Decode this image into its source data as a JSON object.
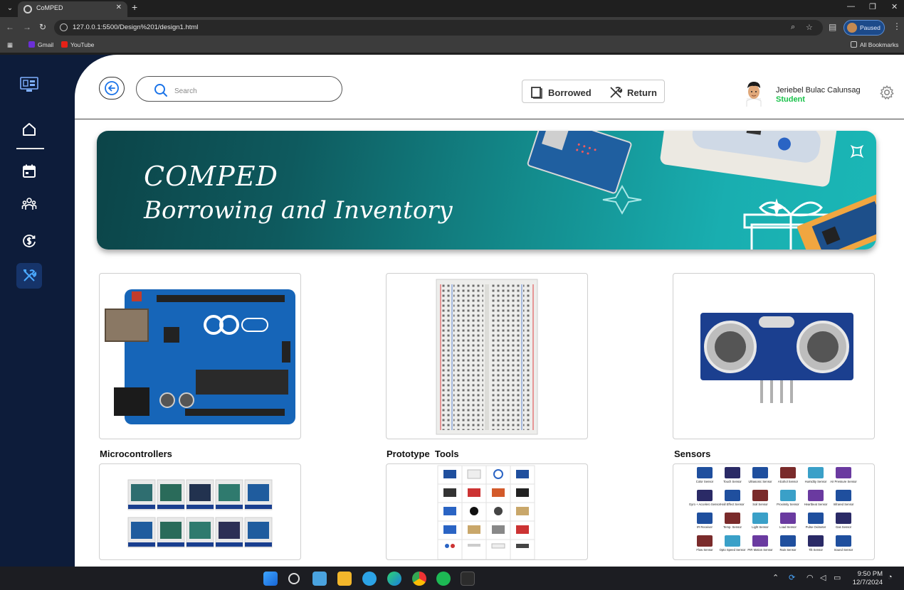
{
  "browser": {
    "tab_title": "CoMPED",
    "url": "127.0.0.1:5500/Design%201/design1.html",
    "profile_status": "Paused",
    "bookmarks": [
      {
        "label": "Gmail",
        "color": "#6b2fd6"
      },
      {
        "label": "YouTube",
        "color": "#e62117"
      }
    ],
    "all_bookmarks": "All Bookmarks"
  },
  "sidebar": {
    "items": [
      {
        "name": "home",
        "icon": "home-icon"
      },
      {
        "name": "calendar",
        "icon": "calendar-icon"
      },
      {
        "name": "users",
        "icon": "users-icon"
      },
      {
        "name": "payment",
        "icon": "dollar-refresh-icon"
      },
      {
        "name": "tools",
        "icon": "tools-icon",
        "active": true
      }
    ]
  },
  "header": {
    "search_placeholder": "Search",
    "borrowed_label": "Borrowed",
    "return_label": "Return",
    "user_name": "Jeriebel Bulac Calunsag",
    "user_role": "Student"
  },
  "banner": {
    "title": "COMPED",
    "subtitle": "Borrowing and Inventory"
  },
  "categories": [
    {
      "label": "Microcontrollers"
    },
    {
      "label": "Prototype  Tools"
    },
    {
      "label": "Sensors"
    }
  ],
  "sensor_list": [
    "Color Sensor",
    "Touch Sensor",
    "Ultrasonic Sensor",
    "Alcohol Sensor",
    "Humidity Sensor",
    "Air Pressure Sensor",
    "Gyro + Accelero Sensor",
    "Hall Effect Sensor",
    "Soil Sensor",
    "Proximity Sensor",
    "Heartbeat Sensor",
    "Infrared Sensor",
    "IR Receiver",
    "Temp. Sensor",
    "Light Sensor",
    "Load Sensor",
    "Pulse Oximeter",
    "Gas Sensor",
    "Flow Sensor",
    "Opto Speed Sensor",
    "PIR Motion Sensor",
    "Rain Sensor",
    "Tilt Sensor",
    "Sound Sensor"
  ],
  "taskbar": {
    "time": "9:50 PM",
    "date": "12/7/2024"
  },
  "colors": {
    "sidebar_bg": "#0d1c3a",
    "active_nav": "#16346a",
    "accent_blue": "#1a73e8",
    "role_green": "#19c24a",
    "banner_teal": "#138b8c"
  }
}
